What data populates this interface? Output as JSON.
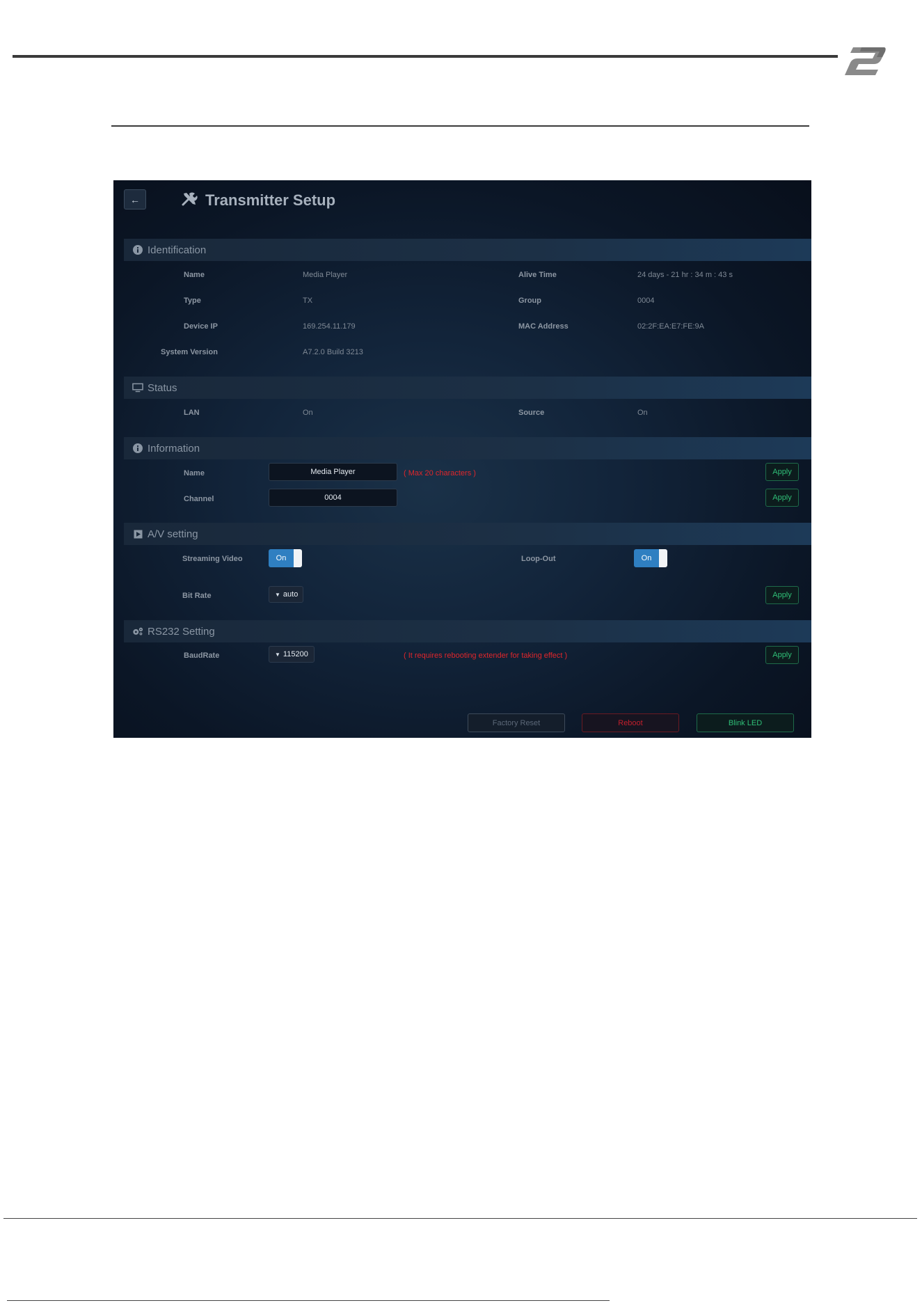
{
  "app": {
    "title": "Transmitter Setup",
    "back_label": "←"
  },
  "sections": {
    "identification": "Identification",
    "status": "Status",
    "information": "Information",
    "av_setting": "A/V setting",
    "rs232_setting": "RS232 Setting"
  },
  "identification": {
    "name_label": "Name",
    "name_value": "Media Player",
    "type_label": "Type",
    "type_value": "TX",
    "device_ip_label": "Device IP",
    "device_ip_value": "169.254.11.179",
    "system_version_label": "System Version",
    "system_version_value": "A7.2.0 Build 3213",
    "alive_time_label": "Alive Time",
    "alive_time_value": "24 days - 21 hr : 34 m : 43 s",
    "group_label": "Group",
    "group_value": "0004",
    "mac_label": "MAC Address",
    "mac_value": "02:2F:EA:E7:FE:9A"
  },
  "status": {
    "lan_label": "LAN",
    "lan_value": "On",
    "source_label": "Source",
    "source_value": "On"
  },
  "information": {
    "name_label": "Name",
    "name_input": "Media Player",
    "name_hint": "( Max 20 characters )",
    "channel_label": "Channel",
    "channel_input": "0004",
    "apply_label": "Apply"
  },
  "av": {
    "streaming_label": "Streaming Video",
    "streaming_state": "On",
    "loopout_label": "Loop-Out",
    "loopout_state": "On",
    "bitrate_label": "Bit Rate",
    "bitrate_value": "auto",
    "apply_label": "Apply"
  },
  "rs232": {
    "baud_label": "BaudRate",
    "baud_value": "115200",
    "hint": "( It requires rebooting extender for taking effect )",
    "apply_label": "Apply"
  },
  "footer_buttons": {
    "factory_reset": "Factory Reset",
    "reboot": "Reboot",
    "blink_led": "Blink LED"
  },
  "colors": {
    "accent_blue": "#2f7fc1",
    "apply_green": "#2fbf77",
    "warning_red": "#e0262b"
  },
  "icons": {
    "brand": "brand-logo-icon",
    "title": "tools-icon",
    "identification": "info-icon",
    "status": "monitor-icon",
    "information": "info-icon",
    "av": "play-icon",
    "rs232": "gears-icon"
  }
}
